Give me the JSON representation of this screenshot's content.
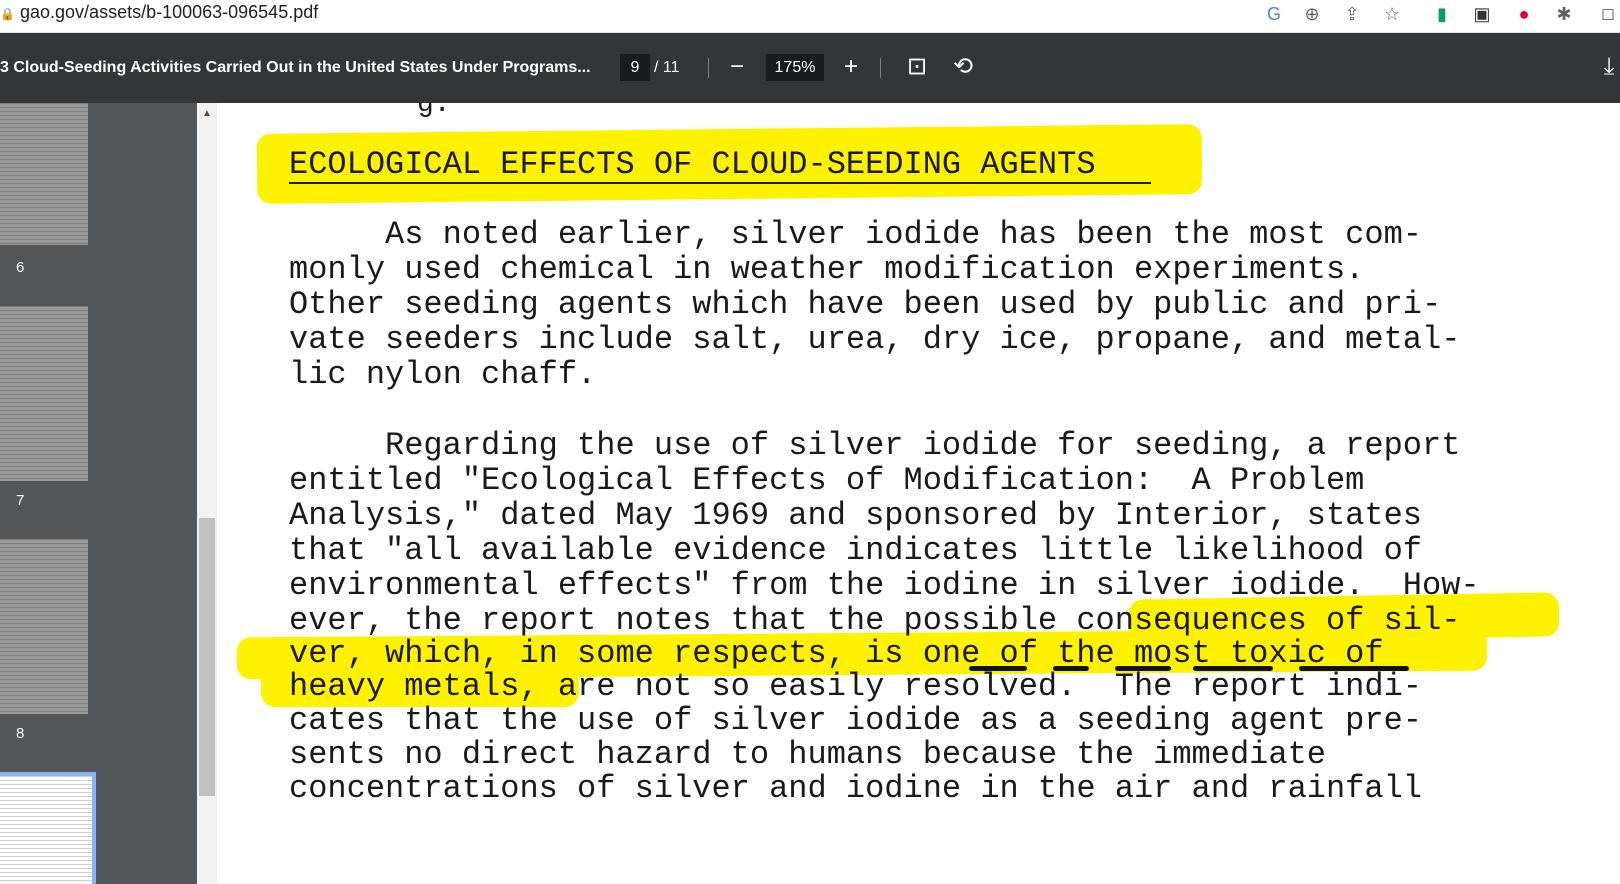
{
  "browser": {
    "url": "gao.gov/assets/b-100063-096545.pdf",
    "extensions": [
      {
        "name": "google-icon",
        "glyph": "G",
        "color": "#4285f4"
      },
      {
        "name": "zoom-icon",
        "glyph": "⊕",
        "color": "#5f6368"
      },
      {
        "name": "share-icon",
        "glyph": "⇪",
        "color": "#5f6368"
      },
      {
        "name": "star-icon",
        "glyph": "☆",
        "color": "#5f6368"
      },
      {
        "name": "bookmark-ext-icon",
        "glyph": "▮",
        "color": "#0f9d58"
      },
      {
        "name": "new-ext-icon",
        "glyph": "▣",
        "color": "#333333"
      },
      {
        "name": "pinterest-icon",
        "glyph": "●",
        "color": "#e60023"
      },
      {
        "name": "puzzle-icon",
        "glyph": "✱",
        "color": "#5f6368"
      },
      {
        "name": "window-icon",
        "glyph": "□",
        "color": "#202124"
      }
    ]
  },
  "toolbar": {
    "title": "3 Cloud-Seeding Activities Carried Out in the United States Under Programs...",
    "current_page": "9",
    "total_pages": "/ 11",
    "zoom_out": "−",
    "zoom": "175%",
    "zoom_in": "+",
    "fit_icon": "⊡",
    "rotate_icon": "⟲",
    "download_icon": "⤓"
  },
  "sidebar": {
    "pages": [
      "6",
      "7",
      "8"
    ]
  },
  "document": {
    "heading": "ECOLOGICAL EFFECTS OF CLOUD-SEEDING AGENTS",
    "stray_top": "g.",
    "lines": [
      "     As noted earlier, silver iodide has been the most com-",
      "monly used chemical in weather modification experiments.",
      "Other seeding agents which have been used by public and pri-",
      "vate seeders include salt, urea, dry ice, propane, and metal-",
      "lic nylon chaff.",
      "     Regarding the use of silver iodide for seeding, a report",
      "entitled \"Ecological Effects of Modification:  A Problem",
      "Analysis,\" dated May 1969 and sponsored by Interior, states",
      "that \"all available evidence indicates little likelihood of",
      "environmental effects\" from the iodine in silver iodide.  How-",
      "ever, the report notes that the possible consequences of sil-",
      "ver, which, in some respects, is one of the most toxic of",
      "heavy metals, are not so easily resolved.  The report indi-",
      "cates that the use of silver iodide as a seeding agent pre-",
      "sents no direct hazard to humans because the immediate",
      "concentrations of silver and iodine in the air and rainfall"
    ]
  },
  "colors": {
    "highlight": "#fff200",
    "toolbar_bg": "#323639",
    "sidebar_bg": "#525659",
    "active_thumb_border": "#8ab4f8"
  }
}
